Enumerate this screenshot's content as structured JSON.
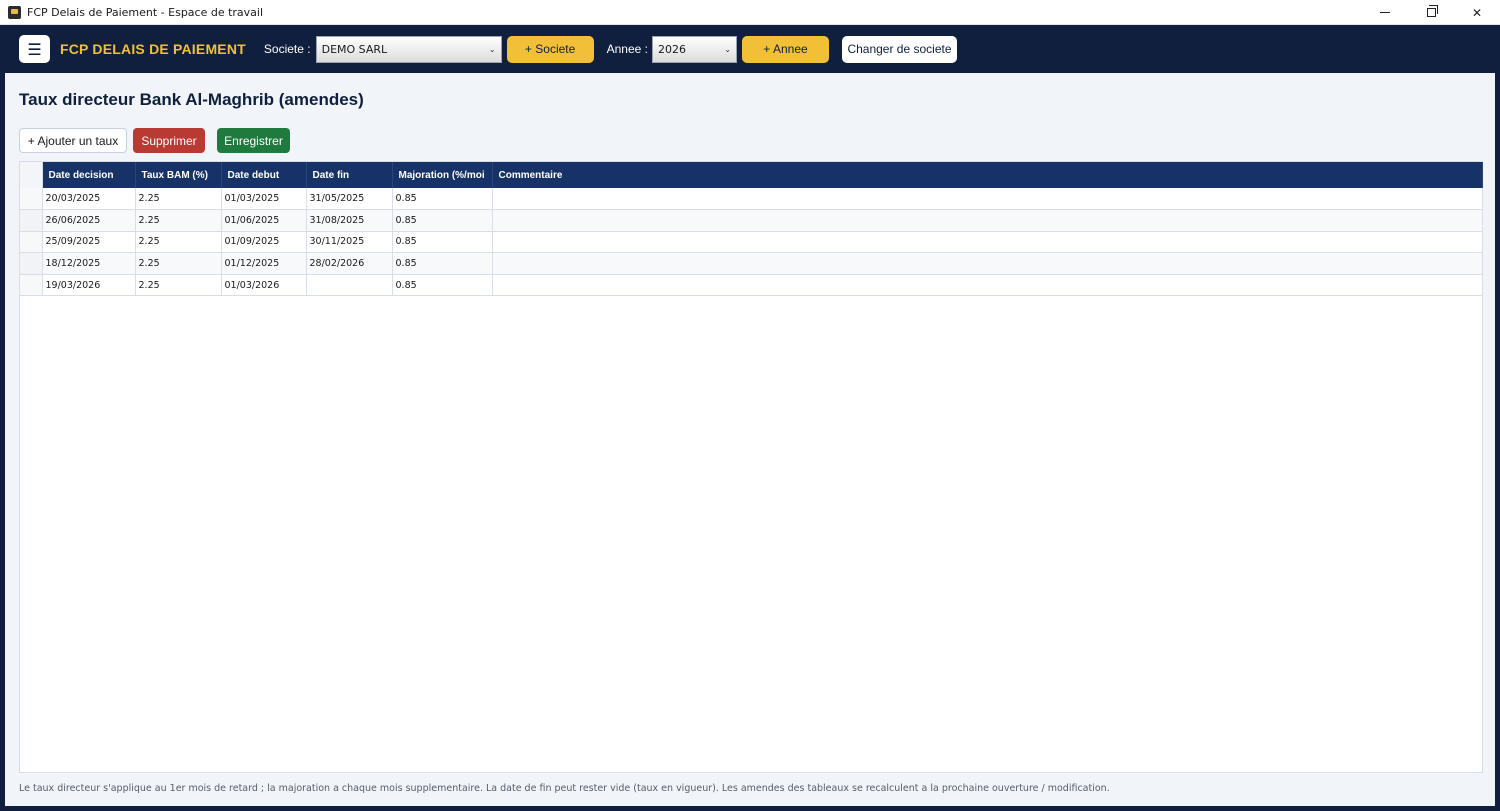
{
  "window": {
    "title": "FCP Delais de Paiement - Espace de travail",
    "controls": {
      "minimize": "",
      "restore": "",
      "close": "✕"
    }
  },
  "header": {
    "menu_icon": "☰",
    "brand": "FCP DELAIS DE PAIEMENT",
    "societe_label": "Societe :",
    "societe_value": "DEMO SARL",
    "add_societe_label": "+ Societe",
    "annee_label": "Annee :",
    "annee_value": "2026",
    "add_annee_label": "+ Annee",
    "changer_label": "Changer de societe",
    "chevron": "⌄"
  },
  "page": {
    "title": "Taux directeur Bank Al-Maghrib (amendes)",
    "toolbar": {
      "add_label": "+ Ajouter un taux",
      "delete_label": "Supprimer",
      "save_label": "Enregistrer"
    }
  },
  "table": {
    "columns": [
      "Date decision",
      "Taux BAM (%)",
      "Date debut",
      "Date fin",
      "Majoration (%/moi",
      "Commentaire"
    ],
    "rows": [
      [
        "20/03/2025",
        "2.25",
        "01/03/2025",
        "31/05/2025",
        "0.85",
        ""
      ],
      [
        "26/06/2025",
        "2.25",
        "01/06/2025",
        "31/08/2025",
        "0.85",
        ""
      ],
      [
        "25/09/2025",
        "2.25",
        "01/09/2025",
        "30/11/2025",
        "0.85",
        ""
      ],
      [
        "18/12/2025",
        "2.25",
        "01/12/2025",
        "28/02/2026",
        "0.85",
        ""
      ],
      [
        "19/03/2026",
        "2.25",
        "01/03/2026",
        "",
        "0.85",
        ""
      ]
    ]
  },
  "footnote": "Le taux directeur s'applique au 1er mois de retard ; la majoration a chaque mois supplementaire. La date de fin peut rester vide (taux en vigueur). Les amendes des tableaux se recalculent a la prochaine ouverture / modification.",
  "colors": {
    "navy": "#0f1f3d",
    "table_header": "#163266",
    "accent_yellow": "#f2c037",
    "danger": "#b83a33",
    "success": "#1f7a3e"
  }
}
